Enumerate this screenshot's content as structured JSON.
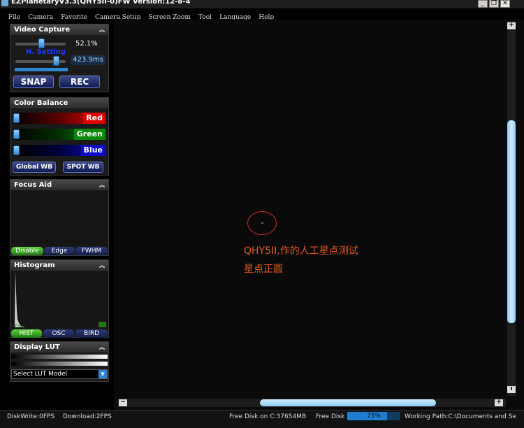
{
  "window": {
    "title": "EZPlanetaryV3.3(QHY5II-0)FW Version:12-8-4",
    "buttons": {
      "minimize": "_",
      "restore": "❐",
      "close": "✕"
    }
  },
  "menu": [
    "File",
    "Camera",
    "Favorite",
    "Camera Setup",
    "Screen Zoom",
    "Tool",
    "Language",
    "Help"
  ],
  "video_capture": {
    "title": "Video Capture",
    "gain_percent": "52.1%",
    "gain_fraction": 0.52,
    "exposure": "423.9ms",
    "exposure_fraction": 0.86,
    "overlay_text": "H. Setting",
    "snap_label": "SNAP",
    "rec_label": "REC"
  },
  "color_balance": {
    "title": "Color Balance",
    "red_label": "Red",
    "green_label": "Green",
    "blue_label": "Blue",
    "global_wb": "Global WB",
    "spot_wb": "SPOT WB"
  },
  "focus_aid": {
    "title": "Focus Aid",
    "tabs": [
      "Disable",
      "Edge",
      "FWHM"
    ],
    "active_tab": "Disable"
  },
  "histogram": {
    "title": "Histogram",
    "tabs": [
      "HIST",
      "OSC",
      "BIRD"
    ],
    "active_tab": "HIST"
  },
  "display_lut": {
    "title": "Display LUT",
    "select_value": "Select LUT Model"
  },
  "viewer": {
    "annotation_line1": "QHY5II,作的人工星点测试",
    "annotation_line2": "星点正圆",
    "hscroll_minus": "−",
    "hscroll_plus": "+"
  },
  "status": {
    "disk_write": "DiskWrite:0FPS",
    "download": "Download:2FPS",
    "free_disk_on": "Free Disk on C:37654MB",
    "free_disk_label": "Free Disk",
    "free_disk_percent": "75%",
    "free_disk_fraction": 0.75,
    "working_path": "Working Path:C:\\Documents and Settings\\"
  },
  "colors": {
    "accent": "#2f86d2",
    "red": "#d00000",
    "green": "#0a8a0a",
    "blue": "#0a0ac8",
    "annotation": "#e05a20"
  }
}
